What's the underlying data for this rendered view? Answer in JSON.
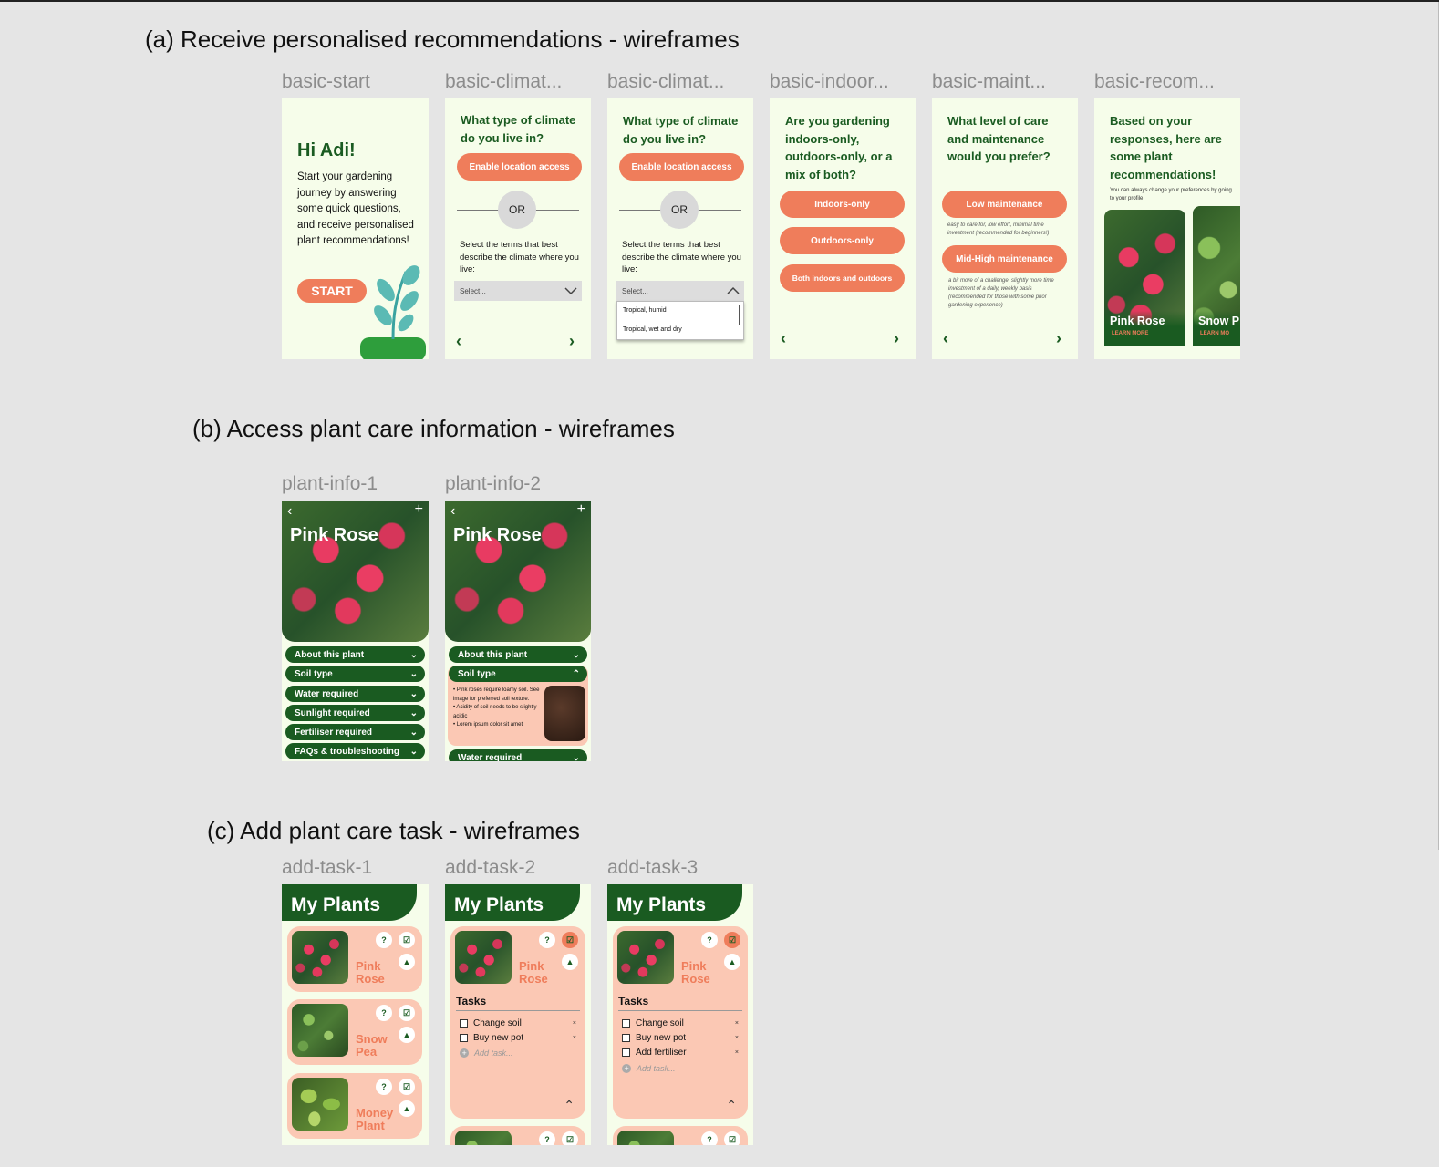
{
  "section_a": {
    "title": "(a) Receive personalised recommendations - wireframes",
    "labels": [
      "basic-start",
      "basic-climat...",
      "basic-climat...",
      "basic-indoor...",
      "basic-maint...",
      "basic-recom..."
    ]
  },
  "start": {
    "greeting": "Hi Adi!",
    "body": "Start your gardening journey by answering some quick questions, and receive personalised plant recommendations!",
    "start_button": "START"
  },
  "climate": {
    "question": "What type of climate do you live in?",
    "location_button": "Enable location access",
    "or": "OR",
    "select_prompt": "Select the terms that best describe the climate where you live:",
    "select_placeholder": "Select...",
    "options": [
      "Tropical, humid",
      "Tropical, wet and dry"
    ]
  },
  "indoor": {
    "question": "Are you gardening indoors-only, outdoors-only, or a mix of both?",
    "options": [
      "Indoors-only",
      "Outdoors-only",
      "Both indoors and outdoors"
    ]
  },
  "maint": {
    "question": "What level of care and maintenance would you prefer?",
    "low": "Low maintenance",
    "low_note": "easy to care for, low effort, minimal time investment (recommended for beginners!)",
    "high": "Mid-High maintenance",
    "high_note": "a bit more of a challenge, slightly more time investment of a daily, weekly basis (recommended for those with some prior gardening experience)"
  },
  "recom": {
    "heading": "Based on your responses, here are some plant recommendations!",
    "sub": "You can always change your preferences by going to your profile",
    "cards": [
      {
        "name": "Pink Rose",
        "link": "LEARN MORE"
      },
      {
        "name": "Snow P",
        "link": "LEARN MO"
      }
    ]
  },
  "section_b": {
    "title": "(b) Access plant care information - wireframes",
    "labels": [
      "plant-info-1",
      "plant-info-2"
    ]
  },
  "plant_info": {
    "title": "Pink Rose",
    "sections": [
      "About this plant",
      "Soil type",
      "Water required",
      "Sunlight required",
      "Fertiliser required",
      "FAQs & troubleshooting"
    ],
    "soil_points": [
      "• Pink roses require loamy soil. See image for preferred soil texture.",
      "• Acidity of soil needs to be slightly acidic",
      "• Lorem ipsum dolor sit amet"
    ]
  },
  "section_c": {
    "title": "(c) Add plant care task - wireframes",
    "labels": [
      "add-task-1",
      "add-task-2",
      "add-task-3"
    ]
  },
  "my_plants": {
    "title": "My Plants",
    "plants": [
      {
        "name": "Pink Rose"
      },
      {
        "name": "Snow Pea"
      },
      {
        "name": "Money Plant"
      }
    ],
    "tasks_heading": "Tasks",
    "tasks": [
      "Change soil",
      "Buy new pot",
      "Add fertiliser"
    ],
    "add_task": "Add task..."
  },
  "icons": {
    "back": "chevron-left-icon",
    "next": "chevron-right-icon",
    "add": "plus-icon",
    "help": "question-icon",
    "task": "checklist-icon",
    "reminder": "bell-icon"
  },
  "colors": {
    "accent": "#ef7d5b",
    "primary": "#1a5b21",
    "frame_bg": "#f6fdea",
    "card_bg": "#fbc8b4"
  }
}
